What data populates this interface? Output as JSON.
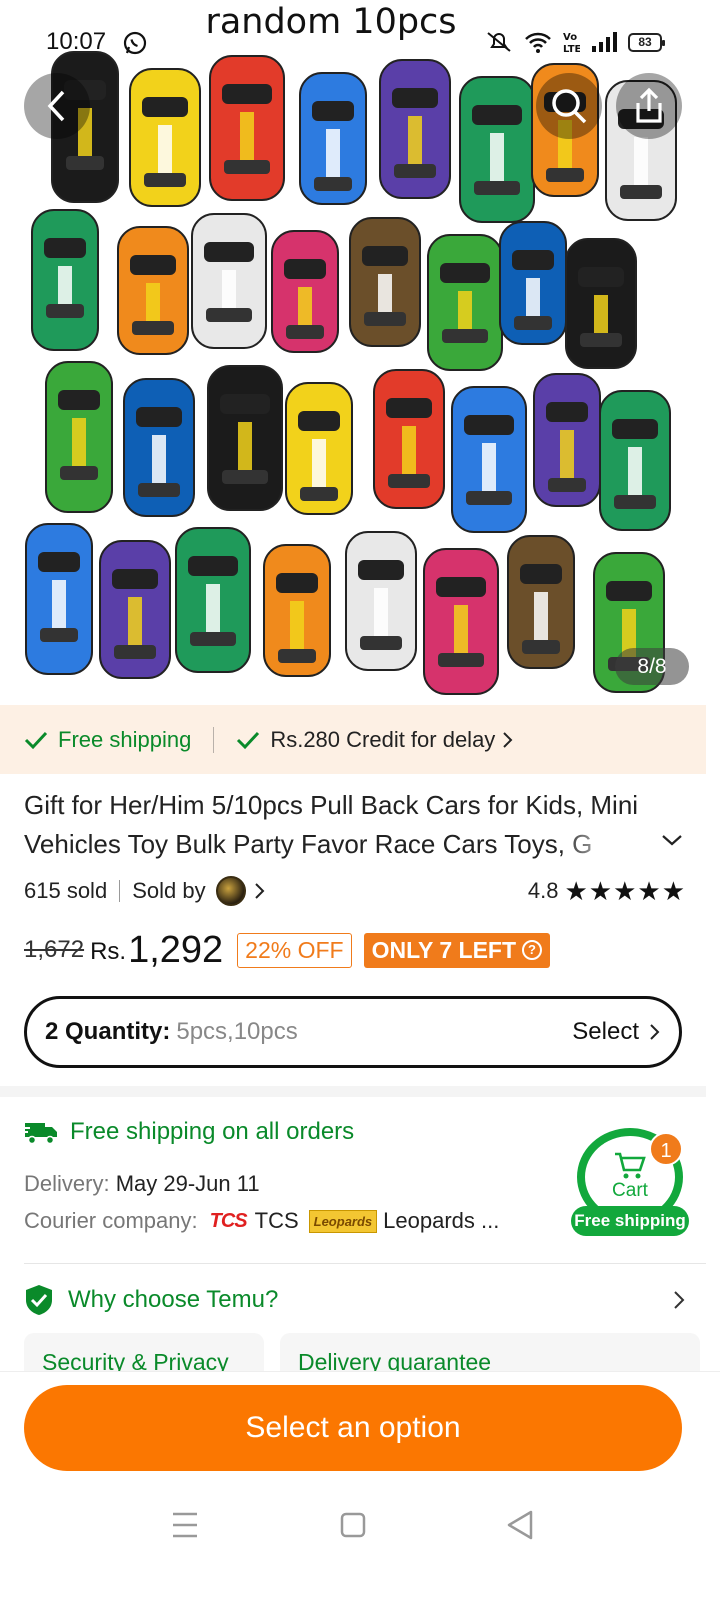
{
  "status_bar": {
    "time": "10:07",
    "battery": "83"
  },
  "image": {
    "caption": "random 10pcs",
    "counter": "8/8"
  },
  "shipping_banner": {
    "free": "Free shipping",
    "credit": "Rs.280 Credit for delay"
  },
  "product": {
    "title": "Gift for Her/Him 5/10pcs Pull Back Cars for Kids, Mini Vehicles Toy Bulk Party Favor Race Cars Toys, G",
    "sold": "615 sold",
    "sold_by": "Sold by",
    "rating": "4.8",
    "stars": "★★★★★",
    "old_price": "1,672",
    "currency": "Rs.",
    "price": "1,292",
    "discount": "22% OFF",
    "stock": "ONLY 7 LEFT"
  },
  "quantity": {
    "label": "2 Quantity:",
    "options": "5pcs,10pcs",
    "select": "Select"
  },
  "delivery": {
    "free_all": "Free shipping on all orders",
    "delivery_label": "Delivery:",
    "delivery_dates": "May 29-Jun 11",
    "courier_label": "Courier company:",
    "tcs_logo": "TCS",
    "courier1": "TCS",
    "leopards_logo": "Leopards",
    "courier2": "Leopards ..."
  },
  "cart": {
    "label": "Cart",
    "count": "1",
    "shipping": "Free shipping"
  },
  "why": {
    "label": "Why choose Temu?"
  },
  "cards": [
    "Security & Privacy",
    "Delivery guarantee"
  ],
  "cta": {
    "label": "Select an option"
  },
  "colors": {
    "accent": "#fb7701",
    "green": "#0a8a2a",
    "banner_bg": "#fdf0e4"
  }
}
